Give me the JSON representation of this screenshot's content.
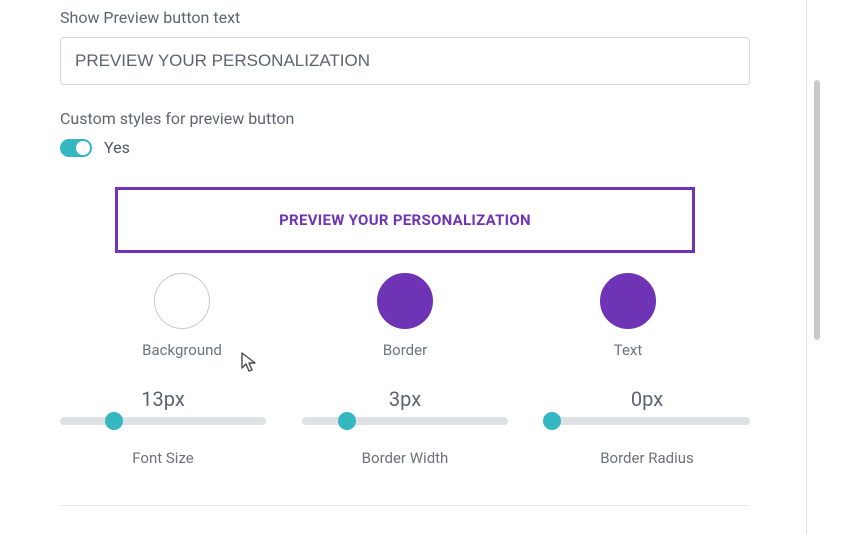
{
  "labels": {
    "preview_text_field": "Show Preview button text",
    "custom_styles": "Custom styles for preview button",
    "toggle_value": "Yes"
  },
  "preview_text_value": "PREVIEW YOUR PERSONALIZATION",
  "preview_button_text": "PREVIEW YOUR PERSONALIZATION",
  "colors": {
    "background": "#ffffff",
    "border": "#6f33b5",
    "text": "#6f33b5"
  },
  "color_labels": {
    "background": "Background",
    "border": "Border",
    "text": "Text"
  },
  "sliders": {
    "font_size": {
      "value": 13,
      "display": "13px",
      "label": "Font Size",
      "percent": 26
    },
    "border_width": {
      "value": 3,
      "display": "3px",
      "label": "Border Width",
      "percent": 22
    },
    "border_radius": {
      "value": 0,
      "display": "0px",
      "label": "Border Radius",
      "percent": 4
    }
  },
  "toggle_on": true
}
